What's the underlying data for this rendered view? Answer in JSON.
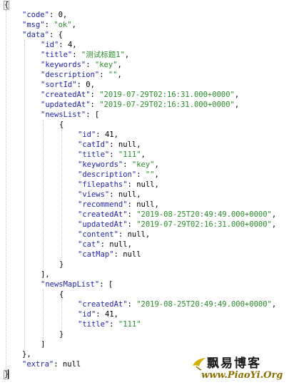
{
  "json_lines": [
    {
      "indent": 0,
      "tokens": [
        {
          "t": "p",
          "v": "{"
        }
      ]
    },
    {
      "indent": 1,
      "tokens": [
        {
          "t": "k",
          "v": "\"code\""
        },
        {
          "t": "p",
          "v": ": "
        },
        {
          "t": "n",
          "v": "0"
        },
        {
          "t": "p",
          "v": ","
        }
      ]
    },
    {
      "indent": 1,
      "tokens": [
        {
          "t": "k",
          "v": "\"msg\""
        },
        {
          "t": "p",
          "v": ": "
        },
        {
          "t": "s",
          "v": "\"ok\""
        },
        {
          "t": "p",
          "v": ","
        }
      ]
    },
    {
      "indent": 1,
      "tokens": [
        {
          "t": "k",
          "v": "\"data\""
        },
        {
          "t": "p",
          "v": ": {"
        }
      ]
    },
    {
      "indent": 2,
      "tokens": [
        {
          "t": "k",
          "v": "\"id\""
        },
        {
          "t": "p",
          "v": ": "
        },
        {
          "t": "n",
          "v": "4"
        },
        {
          "t": "p",
          "v": ","
        }
      ]
    },
    {
      "indent": 2,
      "tokens": [
        {
          "t": "k",
          "v": "\"title\""
        },
        {
          "t": "p",
          "v": ": "
        },
        {
          "t": "s",
          "v": "\"测试标题1\""
        },
        {
          "t": "p",
          "v": ","
        }
      ]
    },
    {
      "indent": 2,
      "tokens": [
        {
          "t": "k",
          "v": "\"keywords\""
        },
        {
          "t": "p",
          "v": ": "
        },
        {
          "t": "s",
          "v": "\"key\""
        },
        {
          "t": "p",
          "v": ","
        }
      ]
    },
    {
      "indent": 2,
      "tokens": [
        {
          "t": "k",
          "v": "\"description\""
        },
        {
          "t": "p",
          "v": ": "
        },
        {
          "t": "s",
          "v": "\"\""
        },
        {
          "t": "p",
          "v": ","
        }
      ]
    },
    {
      "indent": 2,
      "tokens": [
        {
          "t": "k",
          "v": "\"sortId\""
        },
        {
          "t": "p",
          "v": ": "
        },
        {
          "t": "n",
          "v": "0"
        },
        {
          "t": "p",
          "v": ","
        }
      ]
    },
    {
      "indent": 2,
      "tokens": [
        {
          "t": "k",
          "v": "\"createdAt\""
        },
        {
          "t": "p",
          "v": ": "
        },
        {
          "t": "s",
          "v": "\"2019-07-29T02:16:31.000+0000\""
        },
        {
          "t": "p",
          "v": ","
        }
      ]
    },
    {
      "indent": 2,
      "tokens": [
        {
          "t": "k",
          "v": "\"updatedAt\""
        },
        {
          "t": "p",
          "v": ": "
        },
        {
          "t": "s",
          "v": "\"2019-07-29T02:16:31.000+0000\""
        },
        {
          "t": "p",
          "v": ","
        }
      ]
    },
    {
      "indent": 2,
      "tokens": [
        {
          "t": "k",
          "v": "\"newsList\""
        },
        {
          "t": "p",
          "v": ": ["
        }
      ]
    },
    {
      "indent": 3,
      "tokens": [
        {
          "t": "p",
          "v": "{"
        }
      ]
    },
    {
      "indent": 4,
      "tokens": [
        {
          "t": "k",
          "v": "\"id\""
        },
        {
          "t": "p",
          "v": ": "
        },
        {
          "t": "n",
          "v": "41"
        },
        {
          "t": "p",
          "v": ","
        }
      ]
    },
    {
      "indent": 4,
      "tokens": [
        {
          "t": "k",
          "v": "\"catId\""
        },
        {
          "t": "p",
          "v": ": "
        },
        {
          "t": "n",
          "v": "null"
        },
        {
          "t": "p",
          "v": ","
        }
      ]
    },
    {
      "indent": 4,
      "tokens": [
        {
          "t": "k",
          "v": "\"title\""
        },
        {
          "t": "p",
          "v": ": "
        },
        {
          "t": "s",
          "v": "\"111\""
        },
        {
          "t": "p",
          "v": ","
        }
      ]
    },
    {
      "indent": 4,
      "tokens": [
        {
          "t": "k",
          "v": "\"keywords\""
        },
        {
          "t": "p",
          "v": ": "
        },
        {
          "t": "s",
          "v": "\"key\""
        },
        {
          "t": "p",
          "v": ","
        }
      ]
    },
    {
      "indent": 4,
      "tokens": [
        {
          "t": "k",
          "v": "\"description\""
        },
        {
          "t": "p",
          "v": ": "
        },
        {
          "t": "s",
          "v": "\"\""
        },
        {
          "t": "p",
          "v": ","
        }
      ]
    },
    {
      "indent": 4,
      "tokens": [
        {
          "t": "k",
          "v": "\"filepaths\""
        },
        {
          "t": "p",
          "v": ": "
        },
        {
          "t": "n",
          "v": "null"
        },
        {
          "t": "p",
          "v": ","
        }
      ]
    },
    {
      "indent": 4,
      "tokens": [
        {
          "t": "k",
          "v": "\"views\""
        },
        {
          "t": "p",
          "v": ": "
        },
        {
          "t": "n",
          "v": "null"
        },
        {
          "t": "p",
          "v": ","
        }
      ]
    },
    {
      "indent": 4,
      "tokens": [
        {
          "t": "k",
          "v": "\"recommend\""
        },
        {
          "t": "p",
          "v": ": "
        },
        {
          "t": "n",
          "v": "null"
        },
        {
          "t": "p",
          "v": ","
        }
      ]
    },
    {
      "indent": 4,
      "tokens": [
        {
          "t": "k",
          "v": "\"createdAt\""
        },
        {
          "t": "p",
          "v": ": "
        },
        {
          "t": "s",
          "v": "\"2019-08-25T20:49:49.000+0000\""
        },
        {
          "t": "p",
          "v": ","
        }
      ]
    },
    {
      "indent": 4,
      "tokens": [
        {
          "t": "k",
          "v": "\"updatedAt\""
        },
        {
          "t": "p",
          "v": ": "
        },
        {
          "t": "s",
          "v": "\"2019-07-29T02:16:31.000+0000\""
        },
        {
          "t": "p",
          "v": ","
        }
      ]
    },
    {
      "indent": 4,
      "tokens": [
        {
          "t": "k",
          "v": "\"content\""
        },
        {
          "t": "p",
          "v": ": "
        },
        {
          "t": "n",
          "v": "null"
        },
        {
          "t": "p",
          "v": ","
        }
      ]
    },
    {
      "indent": 4,
      "tokens": [
        {
          "t": "k",
          "v": "\"cat\""
        },
        {
          "t": "p",
          "v": ": "
        },
        {
          "t": "n",
          "v": "null"
        },
        {
          "t": "p",
          "v": ","
        }
      ]
    },
    {
      "indent": 4,
      "tokens": [
        {
          "t": "k",
          "v": "\"catMap\""
        },
        {
          "t": "p",
          "v": ": "
        },
        {
          "t": "n",
          "v": "null"
        }
      ]
    },
    {
      "indent": 3,
      "tokens": [
        {
          "t": "p",
          "v": "}"
        }
      ]
    },
    {
      "indent": 2,
      "tokens": [
        {
          "t": "p",
          "v": "],"
        }
      ]
    },
    {
      "indent": 2,
      "tokens": [
        {
          "t": "k",
          "v": "\"newsMapList\""
        },
        {
          "t": "p",
          "v": ": ["
        }
      ]
    },
    {
      "indent": 3,
      "tokens": [
        {
          "t": "p",
          "v": "{"
        }
      ]
    },
    {
      "indent": 4,
      "tokens": [
        {
          "t": "k",
          "v": "\"createdAt\""
        },
        {
          "t": "p",
          "v": ": "
        },
        {
          "t": "s",
          "v": "\"2019-08-25T20:49:49.000+0000\""
        },
        {
          "t": "p",
          "v": ","
        }
      ]
    },
    {
      "indent": 4,
      "tokens": [
        {
          "t": "k",
          "v": "\"id\""
        },
        {
          "t": "p",
          "v": ": "
        },
        {
          "t": "n",
          "v": "41"
        },
        {
          "t": "p",
          "v": ","
        }
      ]
    },
    {
      "indent": 4,
      "tokens": [
        {
          "t": "k",
          "v": "\"title\""
        },
        {
          "t": "p",
          "v": ": "
        },
        {
          "t": "s",
          "v": "\"111\""
        }
      ]
    },
    {
      "indent": 3,
      "tokens": [
        {
          "t": "p",
          "v": "}"
        }
      ]
    },
    {
      "indent": 2,
      "tokens": [
        {
          "t": "p",
          "v": "]"
        }
      ]
    },
    {
      "indent": 1,
      "tokens": [
        {
          "t": "p",
          "v": "},"
        }
      ]
    },
    {
      "indent": 1,
      "tokens": [
        {
          "t": "k",
          "v": "\"extra\""
        },
        {
          "t": "p",
          "v": ": "
        },
        {
          "t": "n",
          "v": "null"
        }
      ]
    },
    {
      "indent": 0,
      "tokens": [
        {
          "t": "p",
          "v": "}"
        }
      ]
    }
  ],
  "watermark": {
    "cn_text": "飘易博客",
    "url_text": "www.PiaoYi.Org"
  },
  "colors": {
    "key": "#2222aa",
    "string": "#2a8b2a",
    "number": "#000000",
    "guide": "#c4c4c4"
  }
}
